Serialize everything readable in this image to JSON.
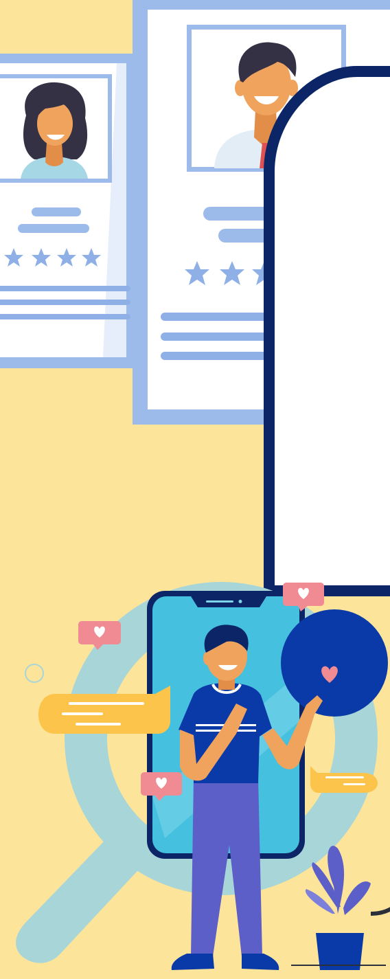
{
  "illustration": {
    "theme": "online dating / candidate profile search",
    "colors": {
      "background": "#fde49b",
      "card_border": "#9dbbea",
      "card_fill": "#ffffff",
      "panel_border": "#0b2566",
      "magnifier": "#a8d5d8",
      "phone_screen": "#45c1df",
      "accent_blue": "#0a3aa8",
      "heart_pink": "#f08a93",
      "bubble_yellow": "#fcc44a",
      "skin": "#f0a35c",
      "hair": "#343145"
    },
    "profile_cards": [
      {
        "person": "woman",
        "rating_stars": 4
      },
      {
        "person": "man",
        "rating_stars": 4
      }
    ],
    "icons": [
      "heart-icon",
      "star-icon",
      "chat-bubble-icon",
      "magnifier-icon",
      "smartphone-icon",
      "plant-icon"
    ]
  }
}
